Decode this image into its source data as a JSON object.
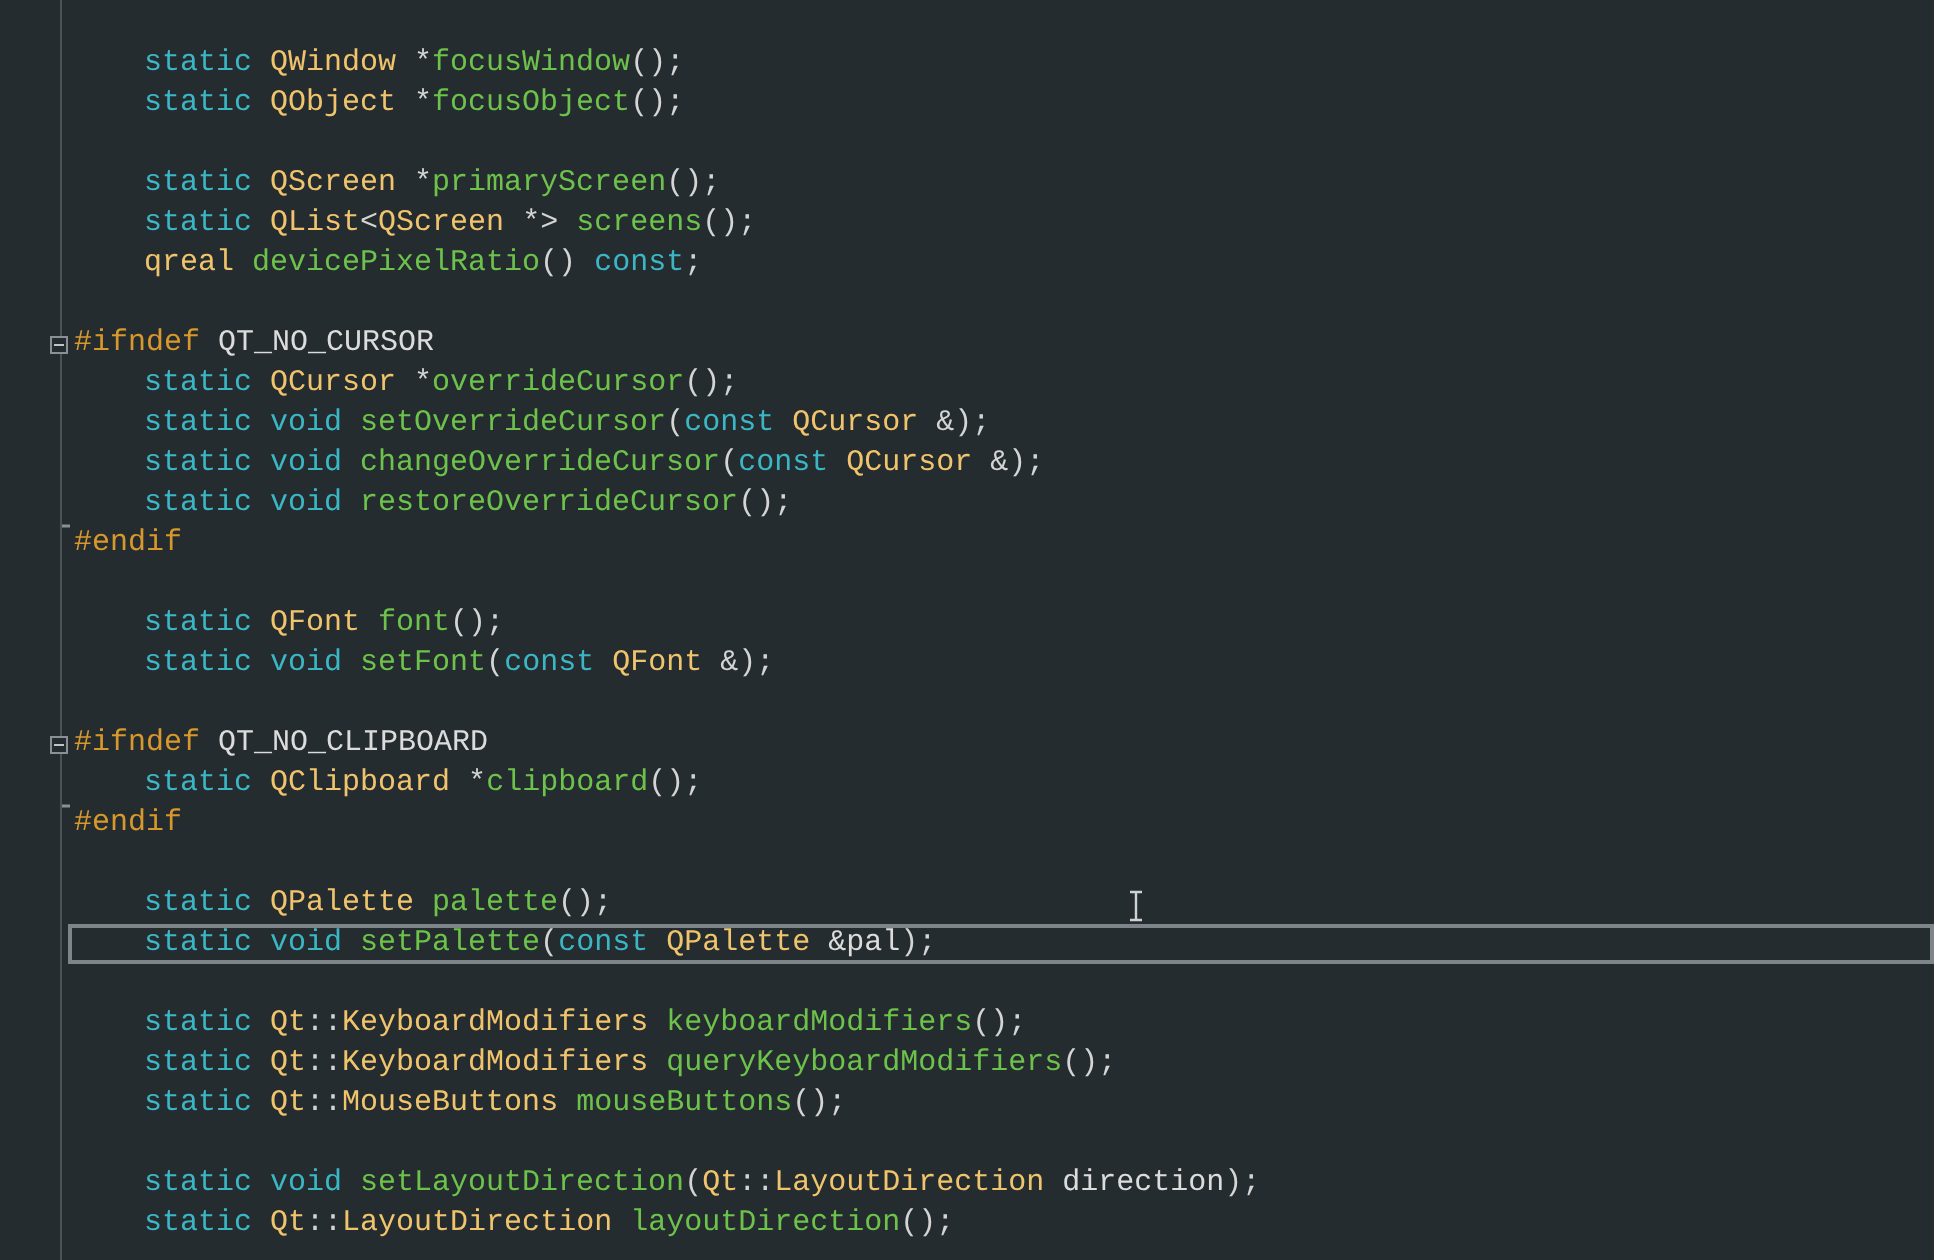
{
  "editor": {
    "lines": [
      {
        "kind": "blank",
        "current": false
      },
      {
        "kind": "code",
        "current": false,
        "tokens": [
          {
            "kind": "kw",
            "text": "static "
          },
          {
            "kind": "type",
            "text": "QWindow "
          },
          {
            "kind": "punct",
            "text": "*"
          },
          {
            "kind": "func",
            "text": "focusWindow"
          },
          {
            "kind": "punct",
            "text": "();"
          }
        ]
      },
      {
        "kind": "code",
        "current": false,
        "tokens": [
          {
            "kind": "kw",
            "text": "static "
          },
          {
            "kind": "type",
            "text": "QObject "
          },
          {
            "kind": "punct",
            "text": "*"
          },
          {
            "kind": "func",
            "text": "focusObject"
          },
          {
            "kind": "punct",
            "text": "();"
          }
        ]
      },
      {
        "kind": "blank",
        "current": false
      },
      {
        "kind": "code",
        "current": false,
        "tokens": [
          {
            "kind": "kw",
            "text": "static "
          },
          {
            "kind": "type",
            "text": "QScreen "
          },
          {
            "kind": "punct",
            "text": "*"
          },
          {
            "kind": "func",
            "text": "primaryScreen"
          },
          {
            "kind": "punct",
            "text": "();"
          }
        ]
      },
      {
        "kind": "code",
        "current": false,
        "tokens": [
          {
            "kind": "kw",
            "text": "static "
          },
          {
            "kind": "type",
            "text": "QList"
          },
          {
            "kind": "punct",
            "text": "<"
          },
          {
            "kind": "type",
            "text": "QScreen "
          },
          {
            "kind": "punct",
            "text": "*> "
          },
          {
            "kind": "func",
            "text": "screens"
          },
          {
            "kind": "punct",
            "text": "();"
          }
        ]
      },
      {
        "kind": "code",
        "current": false,
        "tokens": [
          {
            "kind": "type",
            "text": "qreal "
          },
          {
            "kind": "func",
            "text": "devicePixelRatio"
          },
          {
            "kind": "punct",
            "text": "() "
          },
          {
            "kind": "kw",
            "text": "const"
          },
          {
            "kind": "punct",
            "text": ";"
          }
        ]
      },
      {
        "kind": "blank",
        "current": false
      },
      {
        "kind": "fold_start",
        "current": false,
        "tokens": [
          {
            "kind": "pp",
            "text": "#ifndef "
          },
          {
            "kind": "ident",
            "text": "QT_NO_CURSOR"
          }
        ]
      },
      {
        "kind": "code",
        "current": false,
        "tokens": [
          {
            "kind": "kw",
            "text": "static "
          },
          {
            "kind": "type",
            "text": "QCursor "
          },
          {
            "kind": "punct",
            "text": "*"
          },
          {
            "kind": "func",
            "text": "overrideCursor"
          },
          {
            "kind": "punct",
            "text": "();"
          }
        ]
      },
      {
        "kind": "code",
        "current": false,
        "tokens": [
          {
            "kind": "kw",
            "text": "static void "
          },
          {
            "kind": "func",
            "text": "setOverrideCursor"
          },
          {
            "kind": "punct",
            "text": "("
          },
          {
            "kind": "kw",
            "text": "const "
          },
          {
            "kind": "type",
            "text": "QCursor "
          },
          {
            "kind": "punct",
            "text": "&);"
          }
        ]
      },
      {
        "kind": "code",
        "current": false,
        "tokens": [
          {
            "kind": "kw",
            "text": "static void "
          },
          {
            "kind": "func",
            "text": "changeOverrideCursor"
          },
          {
            "kind": "punct",
            "text": "("
          },
          {
            "kind": "kw",
            "text": "const "
          },
          {
            "kind": "type",
            "text": "QCursor "
          },
          {
            "kind": "punct",
            "text": "&);"
          }
        ]
      },
      {
        "kind": "code",
        "current": false,
        "tokens": [
          {
            "kind": "kw",
            "text": "static void "
          },
          {
            "kind": "func",
            "text": "restoreOverrideCursor"
          },
          {
            "kind": "punct",
            "text": "();"
          }
        ]
      },
      {
        "kind": "fold_end",
        "current": false,
        "tokens": [
          {
            "kind": "pp",
            "text": "#endif"
          }
        ]
      },
      {
        "kind": "blank",
        "current": false
      },
      {
        "kind": "code",
        "current": false,
        "tokens": [
          {
            "kind": "kw",
            "text": "static "
          },
          {
            "kind": "type",
            "text": "QFont "
          },
          {
            "kind": "func",
            "text": "font"
          },
          {
            "kind": "punct",
            "text": "();"
          }
        ]
      },
      {
        "kind": "code",
        "current": false,
        "tokens": [
          {
            "kind": "kw",
            "text": "static void "
          },
          {
            "kind": "func",
            "text": "setFont"
          },
          {
            "kind": "punct",
            "text": "("
          },
          {
            "kind": "kw",
            "text": "const "
          },
          {
            "kind": "type",
            "text": "QFont "
          },
          {
            "kind": "punct",
            "text": "&);"
          }
        ]
      },
      {
        "kind": "blank",
        "current": false
      },
      {
        "kind": "fold_start",
        "current": false,
        "tokens": [
          {
            "kind": "pp",
            "text": "#ifndef "
          },
          {
            "kind": "ident",
            "text": "QT_NO_CLIPBOARD"
          }
        ]
      },
      {
        "kind": "code",
        "current": false,
        "tokens": [
          {
            "kind": "kw",
            "text": "static "
          },
          {
            "kind": "type",
            "text": "QClipboard "
          },
          {
            "kind": "punct",
            "text": "*"
          },
          {
            "kind": "func",
            "text": "clipboard"
          },
          {
            "kind": "punct",
            "text": "();"
          }
        ]
      },
      {
        "kind": "fold_end",
        "current": false,
        "tokens": [
          {
            "kind": "pp",
            "text": "#endif"
          }
        ]
      },
      {
        "kind": "blank",
        "current": false
      },
      {
        "kind": "code",
        "current": false,
        "tokens": [
          {
            "kind": "kw",
            "text": "static "
          },
          {
            "kind": "type",
            "text": "QPalette "
          },
          {
            "kind": "func",
            "text": "palette"
          },
          {
            "kind": "punct",
            "text": "();"
          }
        ]
      },
      {
        "kind": "code",
        "current": true,
        "tokens": [
          {
            "kind": "kw",
            "text": "static void "
          },
          {
            "kind": "func",
            "text": "setPalette"
          },
          {
            "kind": "punct",
            "text": "("
          },
          {
            "kind": "kw",
            "text": "const "
          },
          {
            "kind": "type",
            "text": "QPalette "
          },
          {
            "kind": "ident",
            "text": "&pal"
          },
          {
            "kind": "punct",
            "text": ");"
          }
        ]
      },
      {
        "kind": "blank",
        "current": false
      },
      {
        "kind": "code",
        "current": false,
        "tokens": [
          {
            "kind": "kw",
            "text": "static "
          },
          {
            "kind": "type",
            "text": "Qt"
          },
          {
            "kind": "punct",
            "text": "::"
          },
          {
            "kind": "type",
            "text": "KeyboardModifiers "
          },
          {
            "kind": "func",
            "text": "keyboardModifiers"
          },
          {
            "kind": "punct",
            "text": "();"
          }
        ]
      },
      {
        "kind": "code",
        "current": false,
        "tokens": [
          {
            "kind": "kw",
            "text": "static "
          },
          {
            "kind": "type",
            "text": "Qt"
          },
          {
            "kind": "punct",
            "text": "::"
          },
          {
            "kind": "type",
            "text": "KeyboardModifiers "
          },
          {
            "kind": "func",
            "text": "queryKeyboardModifiers"
          },
          {
            "kind": "punct",
            "text": "();"
          }
        ]
      },
      {
        "kind": "code",
        "current": false,
        "tokens": [
          {
            "kind": "kw",
            "text": "static "
          },
          {
            "kind": "type",
            "text": "Qt"
          },
          {
            "kind": "punct",
            "text": "::"
          },
          {
            "kind": "type",
            "text": "MouseButtons "
          },
          {
            "kind": "func",
            "text": "mouseButtons"
          },
          {
            "kind": "punct",
            "text": "();"
          }
        ]
      },
      {
        "kind": "blank",
        "current": false
      },
      {
        "kind": "code",
        "current": false,
        "tokens": [
          {
            "kind": "kw",
            "text": "static void "
          },
          {
            "kind": "func",
            "text": "setLayoutDirection"
          },
          {
            "kind": "punct",
            "text": "("
          },
          {
            "kind": "type",
            "text": "Qt"
          },
          {
            "kind": "punct",
            "text": "::"
          },
          {
            "kind": "type",
            "text": "LayoutDirection "
          },
          {
            "kind": "ident",
            "text": "direction"
          },
          {
            "kind": "punct",
            "text": ");"
          }
        ]
      },
      {
        "kind": "code",
        "current": false,
        "tokens": [
          {
            "kind": "kw",
            "text": "static "
          },
          {
            "kind": "type",
            "text": "Qt"
          },
          {
            "kind": "punct",
            "text": "::"
          },
          {
            "kind": "type",
            "text": "LayoutDirection "
          },
          {
            "kind": "func",
            "text": "layoutDirection"
          },
          {
            "kind": "punct",
            "text": "();"
          }
        ]
      }
    ]
  }
}
